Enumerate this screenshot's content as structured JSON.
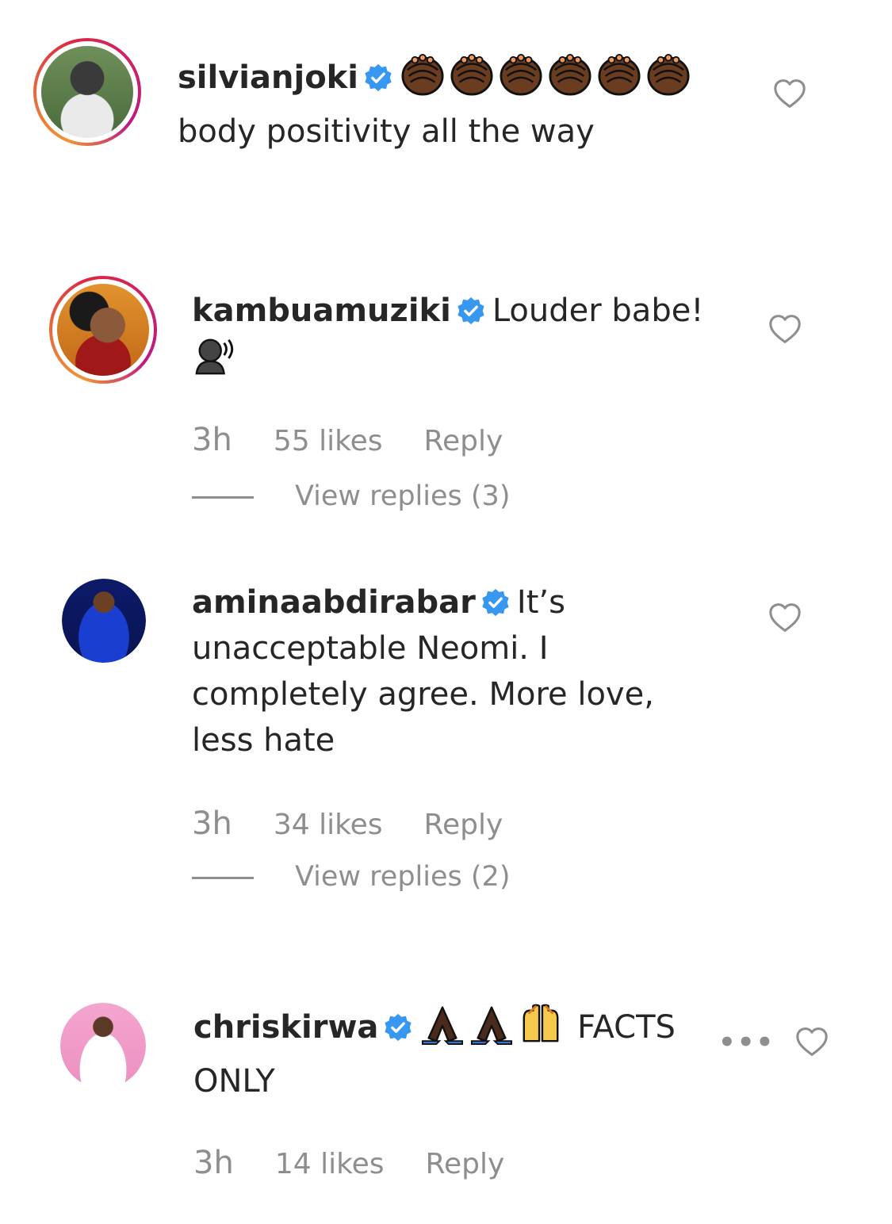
{
  "comments": [
    {
      "username": "silvianjoki",
      "text": "body positivity all the way",
      "emojis": [
        "clap-icon",
        "clap-icon",
        "clap-icon",
        "clap-icon",
        "clap-icon",
        "clap-icon"
      ]
    },
    {
      "username": "kambuamuziki",
      "text": "Louder babe!",
      "emoji": "speaking-head-icon",
      "time": "3h",
      "likes": "55 likes",
      "reply": "Reply",
      "view_replies": "View replies (3)"
    },
    {
      "username": "aminaabdirabar",
      "text_line1": "It’s",
      "text_line2": "unacceptable Neomi. I",
      "text_line3": "completely agree. More love,",
      "text_line4": "less hate",
      "time": "3h",
      "likes": "34 likes",
      "reply": "Reply",
      "view_replies": "View replies (2)"
    },
    {
      "username": "chriskirwa",
      "emojis": [
        "folded-hands-icon",
        "folded-hands-icon",
        "raised-hands-icon"
      ],
      "text_line1": "FACTS",
      "text_line2": "ONLY",
      "time": "3h",
      "likes": "14 likes",
      "reply": "Reply",
      "more": "•••"
    }
  ],
  "colors": {
    "text": "#262626",
    "meta": "#8e8e8e",
    "verified": "#3897f0",
    "skin_dark": "#7a4a2a"
  }
}
